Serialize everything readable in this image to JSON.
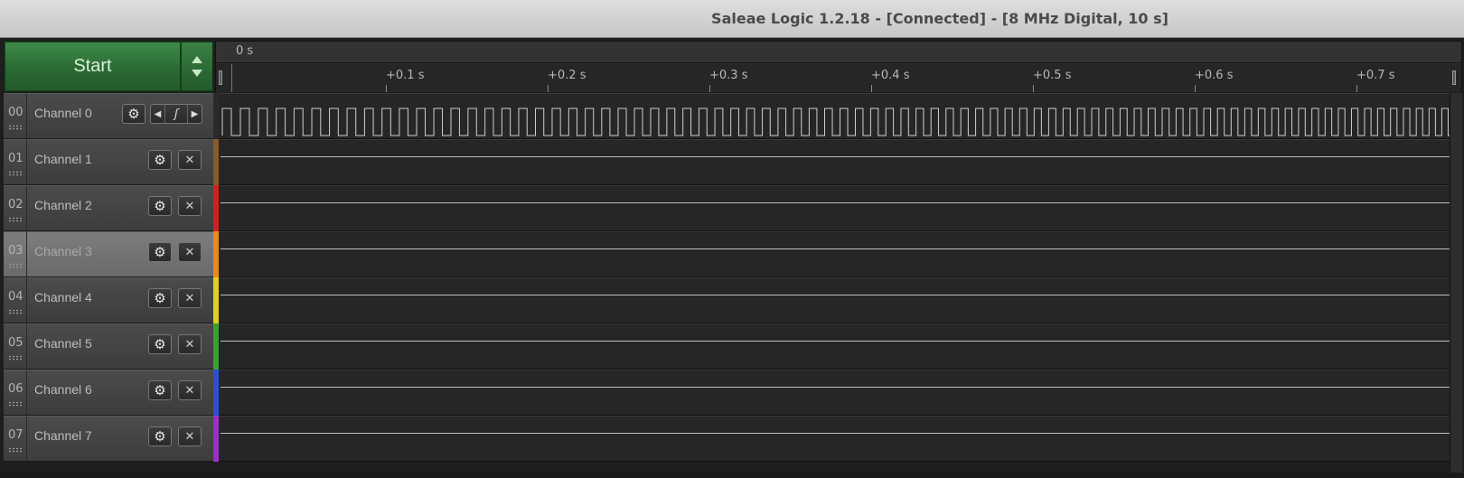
{
  "window": {
    "title": "Saleae Logic 1.2.18 - [Connected] - [8 MHz Digital, 10 s]"
  },
  "capture": {
    "start_label": "Start"
  },
  "timeline": {
    "origin_label": "0 s",
    "ticks": [
      "+0.1 s",
      "+0.2 s",
      "+0.3 s",
      "+0.4 s",
      "+0.5 s",
      "+0.6 s",
      "+0.7 s"
    ]
  },
  "channels": [
    {
      "num": "00",
      "name": "Channel 0",
      "color": "#2a2a2a",
      "signal": "clock",
      "controls": "trigger"
    },
    {
      "num": "01",
      "name": "Channel 1",
      "color": "#8a5a2b",
      "signal": "low",
      "controls": "close"
    },
    {
      "num": "02",
      "name": "Channel 2",
      "color": "#d02020",
      "signal": "low",
      "controls": "close"
    },
    {
      "num": "03",
      "name": "Channel 3",
      "color": "#e8891a",
      "signal": "low",
      "controls": "close",
      "selected": true
    },
    {
      "num": "04",
      "name": "Channel 4",
      "color": "#e0d020",
      "signal": "low",
      "controls": "close"
    },
    {
      "num": "05",
      "name": "Channel 5",
      "color": "#3aa030",
      "signal": "low",
      "controls": "close"
    },
    {
      "num": "06",
      "name": "Channel 6",
      "color": "#2f4fd0",
      "signal": "low",
      "controls": "close"
    },
    {
      "num": "07",
      "name": "Channel 7",
      "color": "#9a30c8",
      "signal": "low",
      "controls": "close"
    }
  ],
  "icons": {
    "settings": "gear-icon",
    "remove": "close-icon",
    "trigger": "trigger-edge-icon"
  }
}
